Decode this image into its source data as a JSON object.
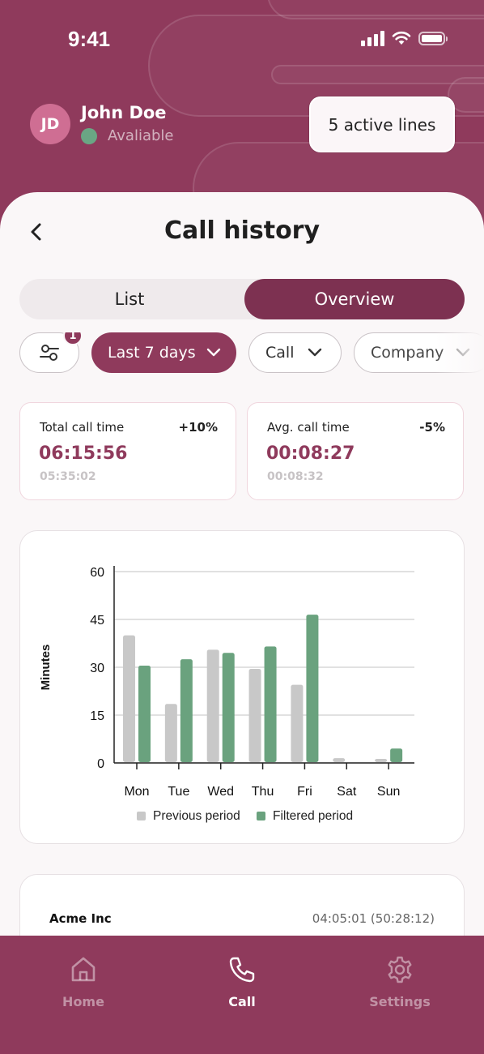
{
  "status_bar": {
    "time": "9:41"
  },
  "user": {
    "initials": "JD",
    "name": "John Doe",
    "status": "Avaliable"
  },
  "active_lines_label": "5 active lines",
  "page": {
    "title": "Call history"
  },
  "segmented": {
    "list_label": "List",
    "overview_label": "Overview",
    "selected": "Overview"
  },
  "filters": {
    "badge_count": "1",
    "date_range": "Last 7 days",
    "type": "Call",
    "company": "Company"
  },
  "stats": [
    {
      "label": "Total call time",
      "change": "+10%",
      "value": "06:15:56",
      "previous": "05:35:02"
    },
    {
      "label": "Avg. call time",
      "change": "-5%",
      "value": "00:08:27",
      "previous": "00:08:32"
    }
  ],
  "colors": {
    "accent": "#8f3a5c",
    "previous": "#c8c8c8",
    "filtered": "#6aa27e"
  },
  "chart_data": {
    "type": "bar",
    "ylabel": "Minutes",
    "xlabel": "",
    "ylim": [
      0,
      60
    ],
    "yticks": [
      0,
      15,
      30,
      45,
      60
    ],
    "grid": true,
    "legend_position": "bottom",
    "categories": [
      "Mon",
      "Tue",
      "Wed",
      "Thu",
      "Fri",
      "Sat",
      "Sun"
    ],
    "series": [
      {
        "name": "Previous period",
        "values": [
          40,
          18.5,
          35.5,
          29.5,
          24.5,
          1.5,
          1
        ]
      },
      {
        "name": "Filtered period",
        "values": [
          30.5,
          32.5,
          34.5,
          36.5,
          46.5,
          0,
          4.5
        ]
      }
    ]
  },
  "company_row": {
    "name": "Acme Inc",
    "time": "04:05:01 (50:28:12)"
  },
  "tabs": [
    {
      "label": "Home",
      "active": false
    },
    {
      "label": "Call",
      "active": true
    },
    {
      "label": "Settings",
      "active": false
    }
  ]
}
